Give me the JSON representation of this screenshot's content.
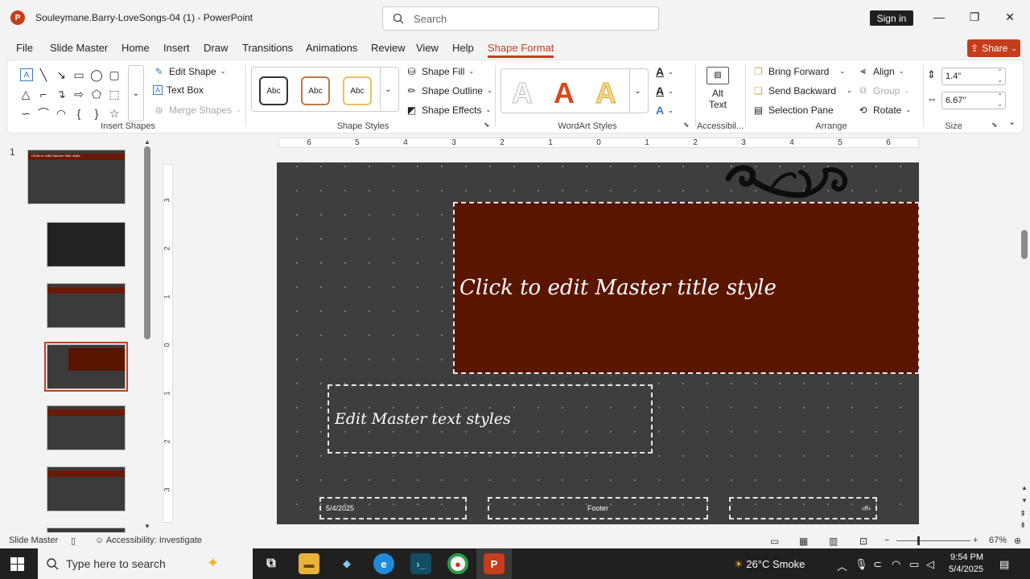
{
  "window": {
    "doc_title": "Souleymane.Barry-LoveSongs-04 (1)  -  PowerPoint",
    "search_placeholder": "Search",
    "sign_in": "Sign in"
  },
  "tabs": [
    "File",
    "Slide Master",
    "Home",
    "Insert",
    "Draw",
    "Transitions",
    "Animations",
    "Review",
    "View",
    "Help",
    "Shape Format"
  ],
  "active_tab": "Shape Format",
  "share_label": "Share",
  "ribbon": {
    "insert_shapes": {
      "label": "Insert Shapes",
      "edit_shape": "Edit Shape",
      "text_box": "Text Box",
      "merge_shapes": "Merge Shapes"
    },
    "shape_styles": {
      "label": "Shape Styles",
      "samples": [
        "Abc",
        "Abc",
        "Abc"
      ],
      "shape_fill": "Shape Fill",
      "shape_outline": "Shape Outline",
      "shape_effects": "Shape Effects"
    },
    "wordart_styles": {
      "label": "WordArt Styles",
      "letters": [
        "A",
        "A",
        "A"
      ]
    },
    "accessibility": {
      "label": "Accessibil...",
      "alt_text": "Alt Text"
    },
    "arrange": {
      "label": "Arrange",
      "bring_forward": "Bring Forward",
      "send_backward": "Send Backward",
      "selection_pane": "Selection Pane",
      "align": "Align",
      "group": "Group",
      "rotate": "Rotate"
    },
    "size": {
      "label": "Size",
      "height": "1.4\"",
      "width": "6.67\""
    }
  },
  "thumbnails": {
    "slide_number": "1",
    "master_title": "Click to edit Master title style"
  },
  "rulers": {
    "horizontal": [
      "6",
      "5",
      "4",
      "3",
      "2",
      "1",
      "0",
      "1",
      "2",
      "3",
      "4",
      "5",
      "6"
    ],
    "vertical": [
      "3",
      "2",
      "1",
      "0",
      "1",
      "2",
      "3"
    ]
  },
  "slide": {
    "title": "Click to edit Master title style",
    "body": "Edit Master text styles",
    "date": "5/4/2025",
    "footer": "Footer",
    "slide_num_symbol": "‹#›"
  },
  "statusbar": {
    "view": "Slide Master",
    "accessibility": "Accessibility: Investigate",
    "zoom": "67%"
  },
  "taskbar": {
    "search_placeholder": "Type here to search",
    "weather": "26°C  Smoke",
    "time": "9:54 PM",
    "date": "5/4/2025"
  }
}
